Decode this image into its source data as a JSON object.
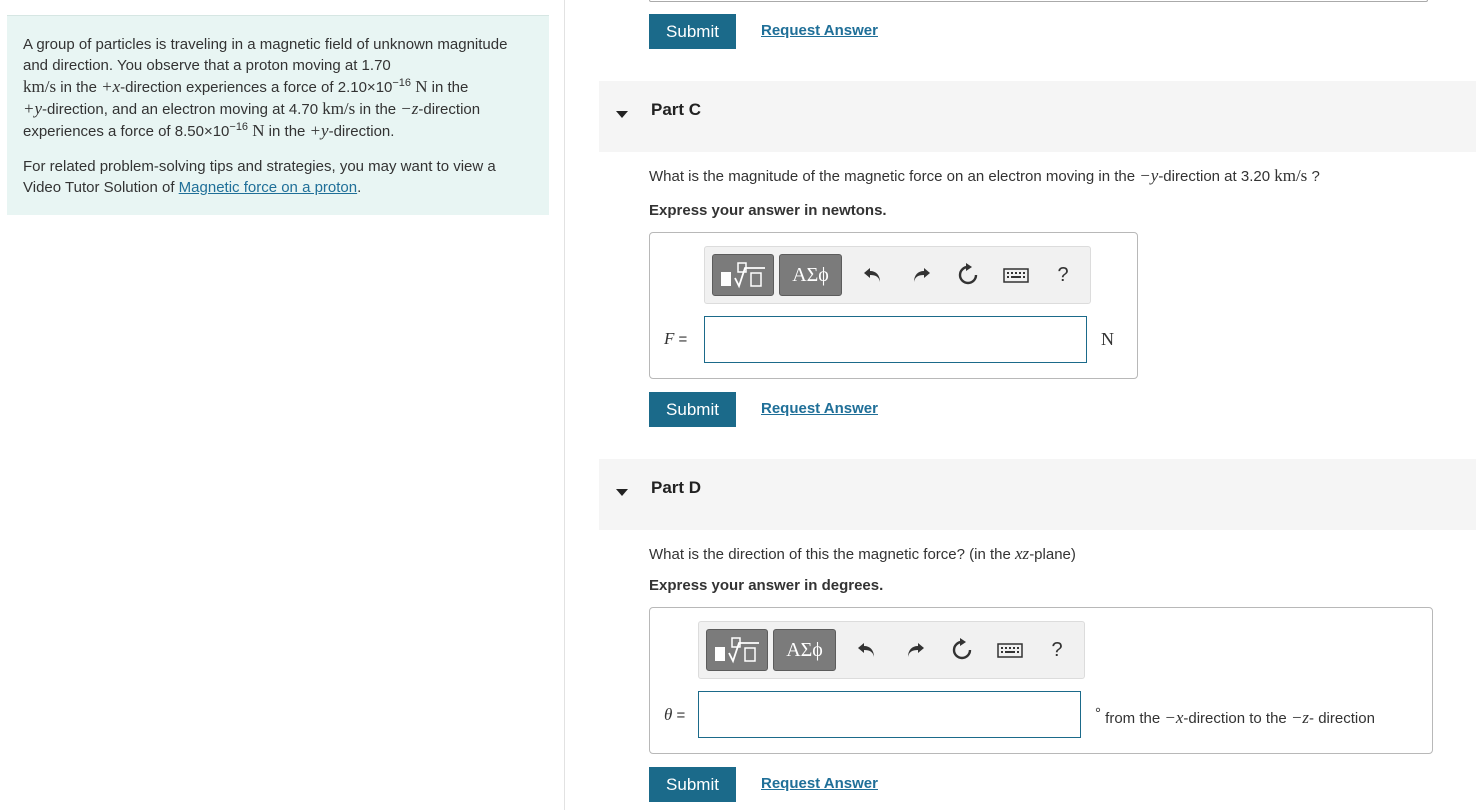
{
  "intro": {
    "p1_a": "A group of particles is traveling in a magnetic field of unknown magnitude and direction. You observe that a proton moving at 1.70",
    "p1_unit1": "km/s",
    "p1_b": " in the ",
    "p1_dir1": "+x",
    "p1_c": "-direction experiences a force of 2.10×10",
    "p1_exp1": "−16",
    "p1_N1": "N",
    "p1_d": " in the",
    "p1_dir2": "+y",
    "p1_e": "-direction, and an electron moving at 4.70 ",
    "p1_unit2": "km/s",
    "p1_f": " in the ",
    "p1_dir3": "−z",
    "p1_g": "-direction experiences a force of 8.50×10",
    "p1_exp2": "−16",
    "p1_N2": "N",
    "p1_h": " in the ",
    "p1_dir4": "+y",
    "p1_i": "-direction.",
    "p2_text": "For related problem-solving tips and strategies, you may want to view a Video Tutor Solution of ",
    "p2_link": "Magnetic force on a proton",
    "p2_end": "."
  },
  "buttons": {
    "submit": "Submit",
    "request_answer": "Request Answer"
  },
  "partC": {
    "title": "Part C",
    "question_a": "What is the magnitude of the magnetic force on an electron moving in the ",
    "question_dir": "−y",
    "question_b": "-direction at 3.20 ",
    "question_unit": "km/s",
    "question_c": " ?",
    "express": "Express your answer in newtons.",
    "var": "F",
    "eq": " =",
    "unit": "N",
    "value": ""
  },
  "partD": {
    "title": "Part D",
    "question_a": "What is the direction of this the magnetic force? (in the ",
    "question_plane": "xz",
    "question_b": "-plane)",
    "express": "Express your answer in degrees.",
    "var": "θ",
    "eq": " =",
    "unit_deg": "°",
    "unit_a": " from the ",
    "unit_dir1": "−x",
    "unit_b": "-direction to the ",
    "unit_dir2": "−z",
    "unit_c": "- direction",
    "value": ""
  },
  "toolbar": {
    "templates_label": "√",
    "greek_label": "ΑΣϕ",
    "help_label": "?"
  }
}
